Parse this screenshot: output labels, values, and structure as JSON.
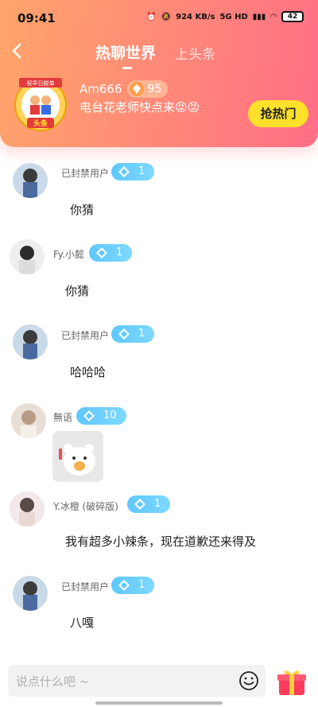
{
  "status": {
    "time": "09:41",
    "net": "924",
    "net_unit": "KB/s",
    "signal": "5G HD",
    "battery": "42"
  },
  "header": {
    "tabs": [
      "热聊世界",
      "上头条"
    ],
    "top_author": "Am666",
    "top_author_level": "95",
    "top_message": "电台花老师快点来😡😡",
    "grab_button": "抢热门",
    "badge_text": "头条",
    "badge_top": "祝早日脱单"
  },
  "messages": [
    {
      "name": "已封禁用户",
      "level": "1",
      "text": "你猜"
    },
    {
      "name": "Fy.小懿",
      "level": "1",
      "text": "你猜"
    },
    {
      "name": "已封禁用户",
      "level": "1",
      "text": "哈哈哈"
    },
    {
      "name": "無语",
      "level": "10",
      "text": ""
    },
    {
      "name": "Y.冰橙 (破碎版)",
      "level": "1",
      "text": "我有超多小辣条，现在道歉还来得及"
    },
    {
      "name": "已封禁用户",
      "level": "1",
      "text": "八嘎"
    }
  ],
  "input": {
    "placeholder": "说点什么吧 ~"
  },
  "colors": {
    "header_start": "#ffa56b",
    "header_end": "#ff6e86",
    "accent_yellow": "#ffe02b",
    "level_blue": "#5ec7ff"
  }
}
